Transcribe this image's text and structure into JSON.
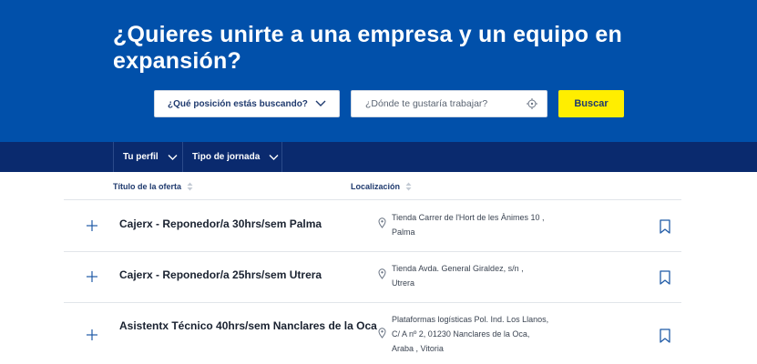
{
  "hero": {
    "title": "¿Quieres unirte a una empresa y un equipo en expansión?"
  },
  "search": {
    "position_label": "¿Qué posición estás buscando?",
    "location_placeholder": "¿Dónde te gustaría trabajar?",
    "search_label": "Buscar"
  },
  "filters": {
    "perfil": "Tu perfil",
    "jornada": "Tipo de jornada"
  },
  "table": {
    "col_title": "Título de la oferta",
    "col_location": "Localización",
    "rows": [
      {
        "title": "Cajerx - Reponedor/a 30hrs/sem Palma",
        "location": "Tienda Carrer de l'Hort de les Ànimes 10 ,\nPalma"
      },
      {
        "title": "Cajerx - Reponedor/a 25hrs/sem Utrera",
        "location": "Tienda Avda. General Giraldez, s/n ,\nUtrera"
      },
      {
        "title": "Asistentx Técnico 40hrs/sem Nanclares de la Oca",
        "location": "Plataformas logísticas Pol. Ind. Los Llanos,\nC/ A nº 2, 01230 Nanclares de la Oca,\nAraba , Vitoria"
      }
    ]
  },
  "colors": {
    "hero_bg": "#0150aa",
    "filterbar_bg": "#0a2a6e",
    "search_button": "#ffee00",
    "accent_text": "#1f3a6e",
    "icon_blue": "#1f5aa6"
  },
  "icons": [
    "chevron-down-icon",
    "target-icon",
    "sort-icon",
    "plus-icon",
    "location-pin-icon",
    "bookmark-icon"
  ]
}
